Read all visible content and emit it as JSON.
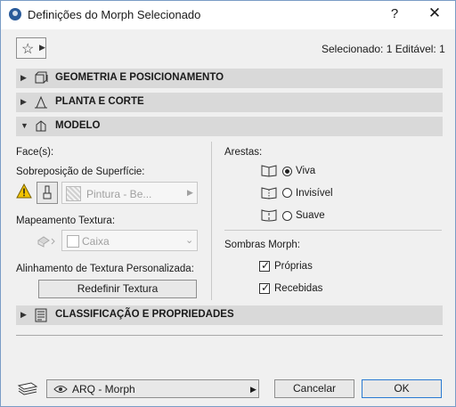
{
  "window": {
    "title": "Definições do Morph Selecionado",
    "help_label": "?",
    "close_label": "✕"
  },
  "header": {
    "favorites_icon": "star-icon",
    "selected_info": "Selecionado: 1 Editável: 1"
  },
  "sections": {
    "geometry": {
      "title": "GEOMETRIA E POSICIONAMENTO",
      "expanded": false
    },
    "plan": {
      "title": "PLANTA E CORTE",
      "expanded": false
    },
    "model": {
      "title": "MODELO",
      "expanded": true
    },
    "classification": {
      "title": "CLASSIFICAÇÃO E PROPRIEDADES",
      "expanded": false
    }
  },
  "model": {
    "faces_label": "Face(s):",
    "surface_override_label": "Sobreposição de Superfície:",
    "surface_value": "Pintura - Be...",
    "texture_mapping_label": "Mapeamento Textura:",
    "texture_mapping_value": "Caixa",
    "custom_alignment_label": "Alinhamento de Textura Personalizada:",
    "reset_texture_label": "Redefinir Textura",
    "edges_label": "Arestas:",
    "edges": [
      {
        "label": "Viva",
        "selected": true
      },
      {
        "label": "Invisível",
        "selected": false
      },
      {
        "label": "Suave",
        "selected": false
      }
    ],
    "shadows_label": "Sombras Morph:",
    "shadows": [
      {
        "label": "Próprias",
        "checked": true
      },
      {
        "label": "Recebidas",
        "checked": true
      }
    ]
  },
  "footer": {
    "layer_value": "ARQ - Morph",
    "cancel_label": "Cancelar",
    "ok_label": "OK"
  },
  "colors": {
    "accent": "#2a5b9a",
    "warning": "#f2c400",
    "section_bg": "#d9d9d9"
  }
}
